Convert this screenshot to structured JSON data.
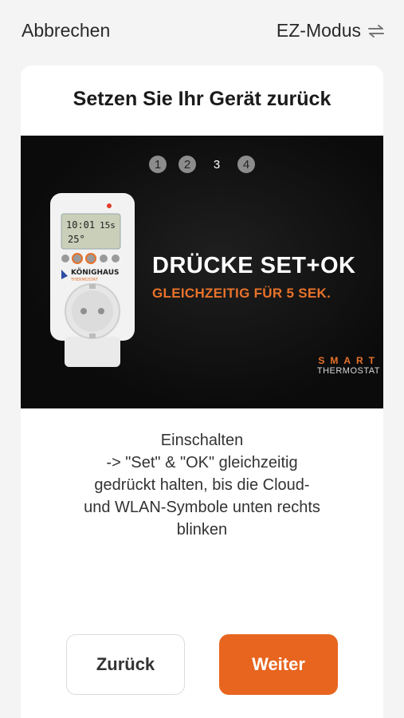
{
  "topbar": {
    "cancel_label": "Abbrechen",
    "mode_label": "EZ-Modus",
    "mode_icon": "swap-icon"
  },
  "card": {
    "title": "Setzen Sie Ihr Gerät zurück"
  },
  "hero": {
    "steps": [
      "1",
      "2",
      "3",
      "4"
    ],
    "active_step": "3",
    "headline": "DRÜCKE SET+OK",
    "subline": "GLEICHZEITIG FÜR 5 SEK.",
    "brand_top": "SMART",
    "brand_bottom": "THERMOSTAT",
    "device": {
      "display_top": "10:01",
      "display_right": "15s",
      "display_temp": "25°",
      "logo_text": "KÖNIGHAUS",
      "logo_sub": "THERMOSTAT"
    }
  },
  "instructions": {
    "lines": [
      "Einschalten",
      "-> \"Set\" & \"OK\" gleichzeitig",
      "gedrückt halten, bis die Cloud-",
      "und WLAN-Symbole unten rechts",
      "blinken"
    ]
  },
  "buttons": {
    "back_label": "Zurück",
    "next_label": "Weiter"
  },
  "colors": {
    "accent": "#e8651f",
    "background": "#f4f4f4",
    "card": "#ffffff"
  }
}
